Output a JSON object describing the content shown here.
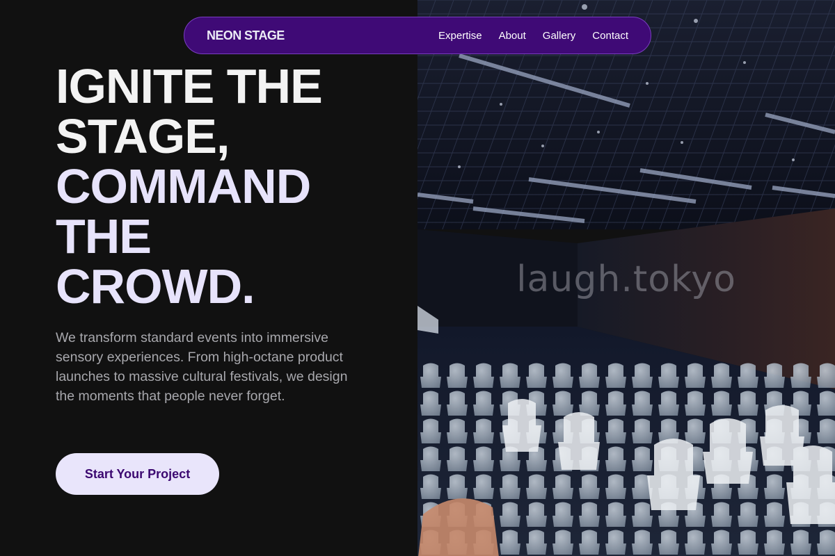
{
  "nav": {
    "brand": "NEON STAGE",
    "links": [
      "Expertise",
      "About",
      "Gallery",
      "Contact"
    ]
  },
  "hero": {
    "title_lines": [
      "IGNITE THE",
      "STAGE,",
      "COMMAND",
      "THE",
      "CROWD."
    ],
    "description": "We transform standard events into immersive sensory experiences. From high-octane product launches to massive cultural festivals, we design the moments that people never forget.",
    "cta_label": "Start Your Project"
  },
  "photo": {
    "subject": "banquet-hall-with-covered-chairs",
    "watermark": "laugh.tokyo"
  },
  "colors": {
    "background": "#111111",
    "nav_bg": "#3f0a76",
    "nav_border": "#7a3ec0",
    "title_lilac": "#e7e3fb",
    "cta_bg": "#e9e5fb",
    "cta_text": "#3b0870",
    "body_text": "#a8a8ad"
  }
}
